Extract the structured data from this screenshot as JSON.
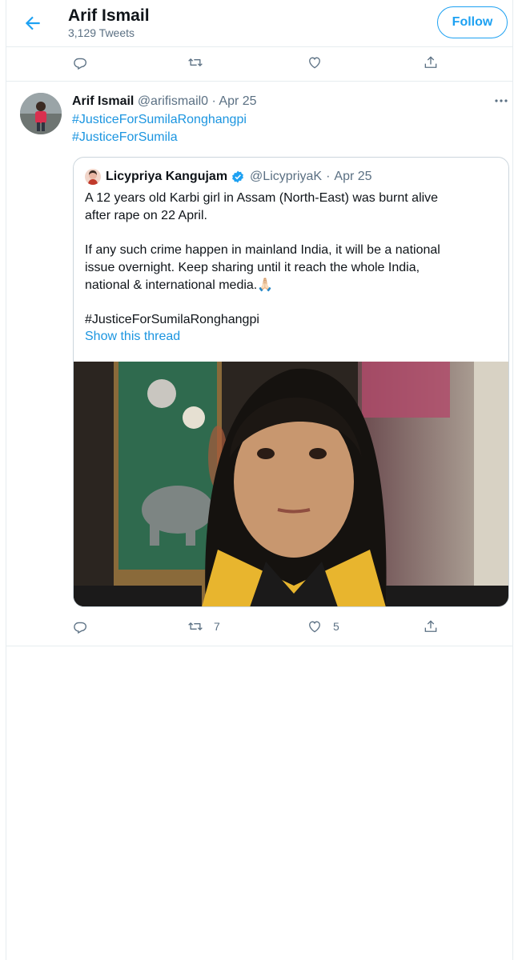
{
  "header": {
    "name": "Arif Ismail",
    "tweet_count": "3,129 Tweets",
    "follow_label": "Follow"
  },
  "tweet": {
    "author_name": "Arif Ismail",
    "handle": "@arifismail0",
    "separator": "·",
    "date": "Apr 25",
    "hashtags": [
      "#JusticeForSumilaRonghangpi",
      "#JusticeForSumila"
    ],
    "retweet_count": "7",
    "like_count": "5"
  },
  "quoted": {
    "author_name": "Licypriya Kangujam",
    "handle": "@LicypriyaK",
    "separator": "·",
    "date": "Apr 25",
    "lines": [
      "A 12 years old Karbi girl in Assam (North-East) was burnt alive",
      "after rape on 22 April.",
      "If any such crime happen in mainland India, it will be a national",
      "issue overnight. Keep sharing until it reach the whole India,",
      "national & international media.🙏🏻",
      "#JusticeForSumilaRonghangpi"
    ],
    "show_thread": "Show this thread"
  },
  "colors": {
    "accent": "#1da1f2",
    "link": "#1b95e0",
    "muted": "#5b7083",
    "border": "#e6ecf0",
    "verified": "#1da1f2"
  },
  "icons": [
    "back-arrow-icon",
    "reply-icon",
    "retweet-icon",
    "like-icon",
    "share-icon",
    "more-icon",
    "verified-badge-icon"
  ]
}
